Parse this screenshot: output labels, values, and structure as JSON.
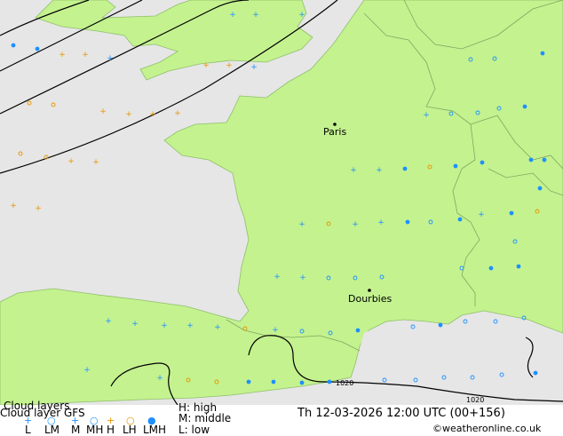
{
  "map": {
    "cities": [
      {
        "name": "Paris"
      },
      {
        "name": "Dourbies"
      }
    ],
    "isobars": [
      "1020",
      "1020"
    ]
  },
  "footer": {
    "title": "Cloud layers",
    "subtitle": "Cloud layer  GFS",
    "legend_right": {
      "high": "H: high",
      "middle": "M: middle",
      "low": "L: low"
    },
    "legend_items": [
      {
        "label": "L",
        "symbol": "+",
        "color": "#1e90ff"
      },
      {
        "label": "LM",
        "symbol": "○",
        "color": "#1e90ff"
      },
      {
        "label": "M",
        "symbol": "+",
        "color": "#1e90ff"
      },
      {
        "label": "MH",
        "symbol": "○",
        "color": "#1e90ff"
      },
      {
        "label": "H",
        "symbol": "+",
        "color": "#e69500"
      },
      {
        "label": "LH",
        "symbol": "○",
        "color": "#e69500"
      },
      {
        "label": "LMH",
        "symbol": "●",
        "color": "#1e90ff"
      }
    ],
    "datetime": "Th 12-03-2026 12:00 UTC (00+156)",
    "copyright": "©weatheronline.co.uk"
  },
  "colors": {
    "land": "#c4f28f",
    "sea": "#e6e6e6",
    "blue": "#1e90ff",
    "orange": "#e69500",
    "border": "#6b8f5a"
  }
}
